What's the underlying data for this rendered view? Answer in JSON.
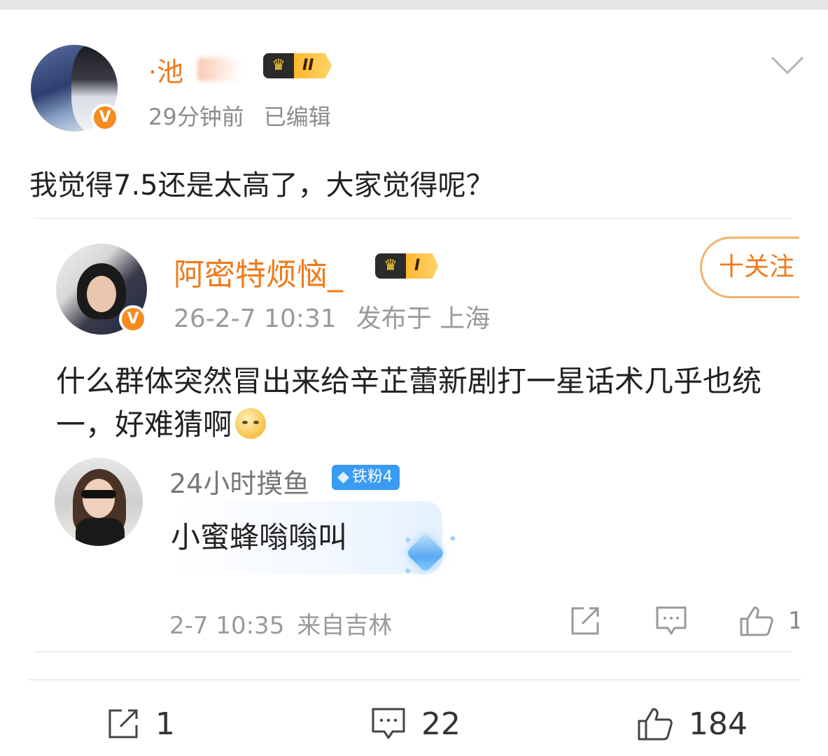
{
  "post": {
    "author": "·池",
    "level_badge": "II",
    "time": "29分钟前",
    "edited": "已编辑",
    "text": "我觉得7.5还是太高了，大家觉得呢？",
    "verified_mark": "V"
  },
  "embedded": {
    "author": "阿密特烦恼_",
    "level_badge": "I",
    "date": "26-2-7 10:31",
    "location": "发布于 上海",
    "follow_label": "十关注",
    "text": "什么群体突然冒出来给辛芷蕾新剧打一星话术几乎也统一，好难猜啊",
    "verified_mark": "V",
    "reply": {
      "author": "24小时摸鱼",
      "fan_badge": "铁粉4",
      "text": "小蜜蜂嗡嗡叫",
      "time": "2-7 10:35",
      "location": "来自吉林",
      "like_count": "1"
    }
  },
  "actions": {
    "repost_count": "1",
    "comment_count": "22",
    "like_count": "184"
  },
  "colors": {
    "accent_orange": "#f07a1a",
    "verified_badge": "#f78b1e",
    "meta_gray": "#8c8c8c",
    "fan_badge_blue": "#3a9bf2"
  },
  "icons": [
    "chevron-down-icon",
    "crown-icon",
    "repost-icon",
    "comment-icon",
    "like-icon",
    "diamond-icon",
    "emoji-icon"
  ]
}
